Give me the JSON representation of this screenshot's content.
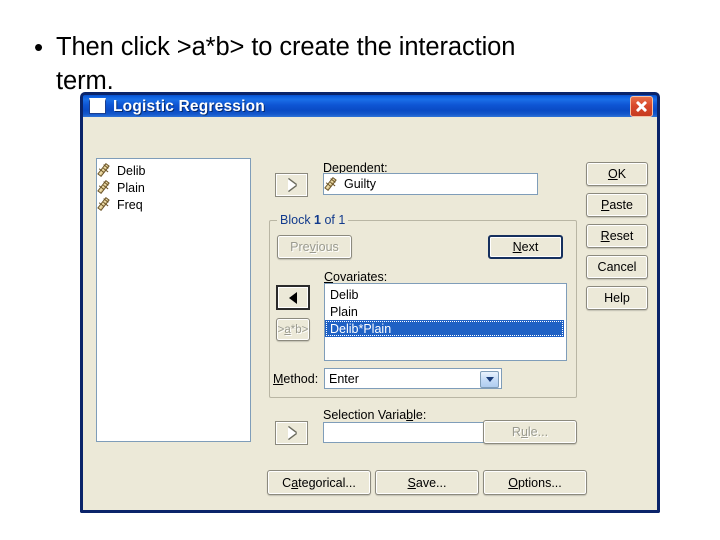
{
  "slide": {
    "bullet_marker": "•",
    "line1": "Then click >a*b>  to create the interaction",
    "line2": "term."
  },
  "dialog": {
    "title": "Logistic Regression",
    "window_icon": "window-icon",
    "close_icon": "close-icon",
    "source_list": {
      "items": [
        {
          "name": "Delib",
          "icon": "scale-variable-icon"
        },
        {
          "name": "Plain",
          "icon": "scale-variable-icon"
        },
        {
          "name": "Freq",
          "icon": "scale-variable-icon"
        }
      ]
    },
    "dependent": {
      "label": "Dependent:",
      "label_mnemonic": "D",
      "label_rest": "ependent:",
      "value": "Guilty",
      "value_icon": "scale-variable-icon",
      "move_button_icon": "arrow-right-icon"
    },
    "block": {
      "legend_prefix": "Block ",
      "legend_current": "1",
      "legend_mid": " of ",
      "legend_total": "1",
      "previous_label": "Previous",
      "previous_mnemonic_pre": "Pre",
      "previous_mnemonic": "v",
      "previous_mnemonic_post": "ious",
      "next_label": "Next",
      "next_mnemonic": "N",
      "next_rest": "ext"
    },
    "covariates": {
      "label_mnemonic": "C",
      "label_rest": "ovariates:",
      "label": "Covariates:",
      "items": [
        {
          "name": "Delib",
          "selected": false
        },
        {
          "name": "Plain",
          "selected": false
        },
        {
          "name": "Delib*Plain",
          "selected": true
        }
      ],
      "move_button_icon": "arrow-left-icon",
      "interaction_button_pre": ">",
      "interaction_button_mnemonic": "a",
      "interaction_button_post": "*b>",
      "interaction_button_label": ">a*b>"
    },
    "method": {
      "label": "Method:",
      "label_mnemonic": "M",
      "label_rest": "ethod:",
      "value": "Enter",
      "dropdown_icon": "chevron-down-icon"
    },
    "selection_variable": {
      "label_pre": "Selection Varia",
      "label_mnemonic": "b",
      "label_post": "le:",
      "label": "Selection Variable:",
      "value": "",
      "move_button_icon": "arrow-right-icon",
      "rule_label": "Rule...",
      "rule_mnemonic_pre": "R",
      "rule_mnemonic": "u",
      "rule_mnemonic_post": "le..."
    },
    "action_buttons": [
      {
        "label": "OK",
        "mnemonic_pre": "",
        "mnemonic": "O",
        "mnemonic_post": "K"
      },
      {
        "label": "Paste",
        "mnemonic_pre": "",
        "mnemonic": "P",
        "mnemonic_post": "aste"
      },
      {
        "label": "Reset",
        "mnemonic_pre": "",
        "mnemonic": "R",
        "mnemonic_post": "eset"
      },
      {
        "label": "Cancel",
        "mnemonic_pre": "C",
        "mnemonic": "",
        "mnemonic_post": "ancel"
      },
      {
        "label": "Help",
        "mnemonic_pre": "H",
        "mnemonic": "",
        "mnemonic_post": "elp"
      }
    ],
    "bottom_buttons": [
      {
        "label": "Categorical...",
        "mnemonic_pre": "C",
        "mnemonic": "a",
        "mnemonic_post": "tegorical..."
      },
      {
        "label": "Save...",
        "mnemonic_pre": "",
        "mnemonic": "S",
        "mnemonic_post": "ave..."
      },
      {
        "label": "Options...",
        "mnemonic_pre": "",
        "mnemonic": "O",
        "mnemonic_post": "ptions..."
      }
    ]
  },
  "colors": {
    "dialog_face": "#ECE9D8",
    "title_blue": "#0D5FE0",
    "title_border": "#0A246A",
    "close_red": "#D8482A",
    "selection_blue": "#1F61C4",
    "legend_blue": "#113A8C",
    "field_border": "#7F9DB9"
  }
}
